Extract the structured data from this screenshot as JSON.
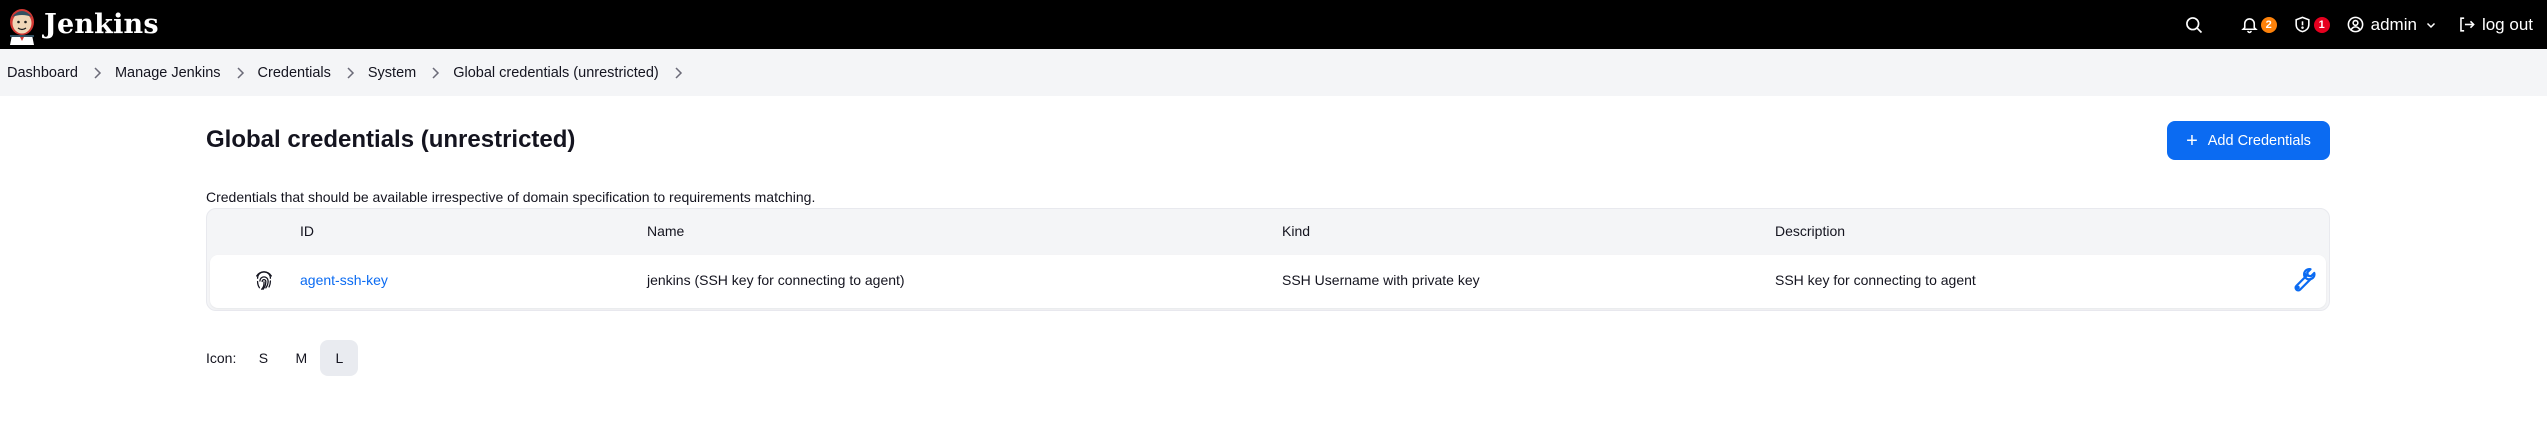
{
  "header": {
    "brand": "Jenkins",
    "notifications_count": "2",
    "security_count": "1",
    "user": "admin",
    "logout": "log out",
    "icons": [
      "search-icon",
      "bell-icon",
      "shield-icon",
      "user-icon",
      "logout-icon"
    ],
    "colors": {
      "background": "#000000",
      "notification_badge": "#fe820a",
      "security_badge": "#e6001f"
    }
  },
  "breadcrumbs": [
    "Dashboard",
    "Manage Jenkins",
    "Credentials",
    "System",
    "Global credentials (unrestricted)"
  ],
  "page": {
    "title": "Global credentials (unrestricted)",
    "add_button": "Add Credentials",
    "description": "Credentials that should be available irrespective of domain specification to requirements matching."
  },
  "table": {
    "columns": [
      "ID",
      "Name",
      "Kind",
      "Description"
    ],
    "rows": [
      {
        "icon": "fingerprint-icon",
        "id": "agent-ssh-key",
        "name": "jenkins (SSH key for connecting to agent)",
        "kind": "SSH Username with private key",
        "description": "SSH key for connecting to agent",
        "action_icon": "wrench-icon"
      }
    ]
  },
  "icon_size": {
    "label": "Icon:",
    "options": [
      "S",
      "M",
      "L"
    ],
    "selected": "L"
  },
  "colors": {
    "accent": "#0b6bf2",
    "header_bg": "#000000",
    "breadcrumb_bg": "#f4f5f7"
  }
}
